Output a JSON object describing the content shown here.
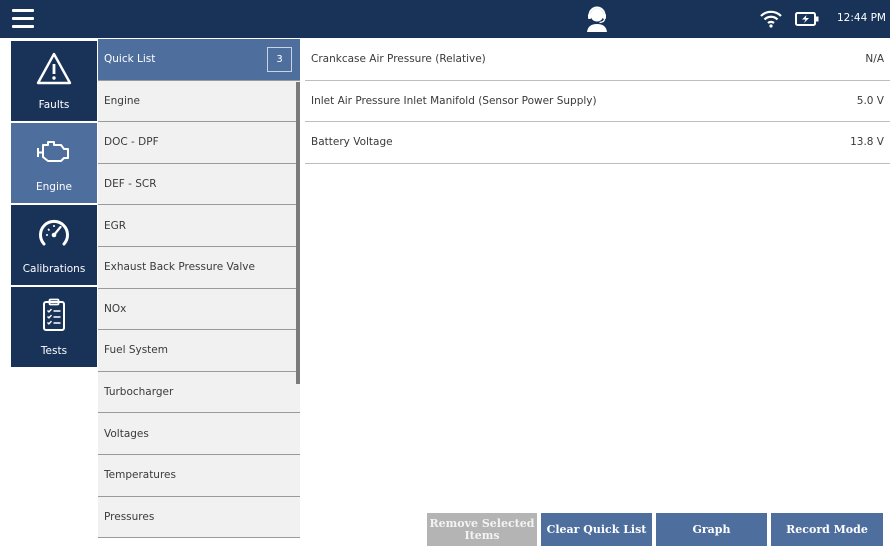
{
  "topbar": {
    "menu_icon": "hamburger-menu-icon",
    "support_icon": "technician-headset-icon",
    "wifi_icon": "wifi-icon",
    "battery_icon": "battery-charging-icon",
    "time": "12:44 PM"
  },
  "nav": {
    "items": [
      {
        "label": "Faults",
        "icon": "warning-triangle-icon",
        "active": false
      },
      {
        "label": "Engine",
        "icon": "engine-icon",
        "active": true
      },
      {
        "label": "Calibrations",
        "icon": "gauge-icon",
        "active": false
      },
      {
        "label": "Tests",
        "icon": "clipboard-checklist-icon",
        "active": false
      }
    ]
  },
  "categories": {
    "items": [
      {
        "label": "Quick List",
        "count": "3",
        "active": true
      },
      {
        "label": "Engine"
      },
      {
        "label": "DOC - DPF"
      },
      {
        "label": "DEF - SCR"
      },
      {
        "label": "EGR"
      },
      {
        "label": "Exhaust Back Pressure Valve"
      },
      {
        "label": "NOx"
      },
      {
        "label": "Fuel System"
      },
      {
        "label": "Turbocharger"
      },
      {
        "label": "Voltages"
      },
      {
        "label": "Temperatures"
      },
      {
        "label": "Pressures"
      }
    ]
  },
  "parameters": [
    {
      "name": "Crankcase Air Pressure (Relative)",
      "value": "N/A"
    },
    {
      "name": "Inlet Air Pressure Inlet Manifold (Sensor Power Supply)",
      "value": "5.0 V"
    },
    {
      "name": "Battery Voltage",
      "value": "13.8 V"
    }
  ],
  "actions": {
    "remove_selected": "Remove Selected Items",
    "clear_quick_list": "Clear Quick List",
    "graph": "Graph",
    "record_mode": "Record Mode"
  },
  "colors": {
    "header": "#183258",
    "accent": "#4e6f9e",
    "disabled": "#b4b4b4",
    "list_bg": "#f1f1f1"
  }
}
